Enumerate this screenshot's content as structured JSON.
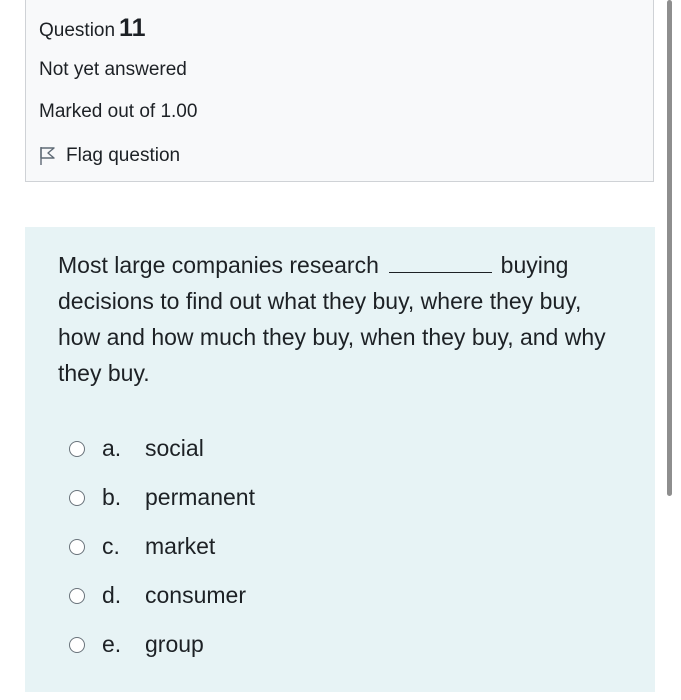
{
  "info": {
    "question_word": "Question",
    "question_number": "11",
    "state": "Not yet answered",
    "grade": "Marked out of 1.00",
    "flag_label": "Flag question",
    "flag_icon": "flag-outline-icon"
  },
  "question": {
    "text_before_blank": "Most large companies research",
    "text_after_blank": "buying decisions to find out what they buy, where they buy, how and how much they buy, when they buy, and why they buy."
  },
  "answers": [
    {
      "letter": "a.",
      "text": "social",
      "selected": false
    },
    {
      "letter": "b.",
      "text": "permanent",
      "selected": false
    },
    {
      "letter": "c.",
      "text": "market",
      "selected": false
    },
    {
      "letter": "d.",
      "text": "consumer",
      "selected": false
    },
    {
      "letter": "e.",
      "text": "group",
      "selected": false
    }
  ],
  "colors": {
    "info_bg": "#f8f9fa",
    "content_bg": "#e7f3f5",
    "text": "#1d2125"
  }
}
